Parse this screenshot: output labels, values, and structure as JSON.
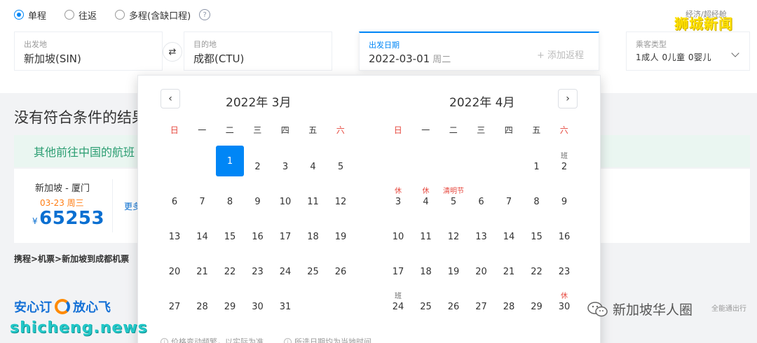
{
  "trip_types": [
    {
      "label": "单程",
      "selected": true
    },
    {
      "label": "往返",
      "selected": false
    },
    {
      "label": "多程(含缺口程)",
      "selected": false
    }
  ],
  "help_glyph": "?",
  "extra_top": "经济/超经舱",
  "search": {
    "from": {
      "label": "出发地",
      "value": "新加坡(SIN)"
    },
    "swap_glyph": "⇄",
    "to": {
      "label": "目的地",
      "value": "成都(CTU)"
    },
    "date": {
      "label": "出发日期",
      "value": "2022-03-01",
      "weekday": "周二",
      "add_return": "+ 添加返程"
    },
    "pax": {
      "label": "乘客类型",
      "value": "1成人  0儿童  0婴儿"
    }
  },
  "results": {
    "no_result_title": "没有符合条件的结果",
    "alt_title": "其他前往中国的航班",
    "alt_card": {
      "route": "新加坡 - 厦门",
      "date": "03-23 周三",
      "currency": "¥",
      "price": "65253",
      "more": "更多"
    },
    "breadcrumb": "携程>机票>新加坡到成都机票",
    "promo_left": "安心订",
    "promo_right": "放心飞",
    "right_note": "全能通出行"
  },
  "calendar": {
    "prev_glyph": "‹",
    "next_glyph": "›",
    "weekday_headers": [
      "日",
      "一",
      "二",
      "三",
      "四",
      "五",
      "六"
    ],
    "months": [
      {
        "title": "2022年 3月",
        "first_weekday": 2,
        "days": 31,
        "selected": 1,
        "tags": {}
      },
      {
        "title": "2022年 4月",
        "first_weekday": 5,
        "days": 30,
        "selected": null,
        "tags": {
          "2": "班",
          "3": "休",
          "4": "休",
          "5": "清明节",
          "24": "班",
          "30": "休"
        }
      }
    ],
    "footer_1": "价格变动频繁，以实际为准",
    "footer_2": "所选日期均为当地时间"
  },
  "watermarks": {
    "top_right": "狮城新闻",
    "site": "shicheng.news",
    "wechat": "新加坡华人圈"
  }
}
